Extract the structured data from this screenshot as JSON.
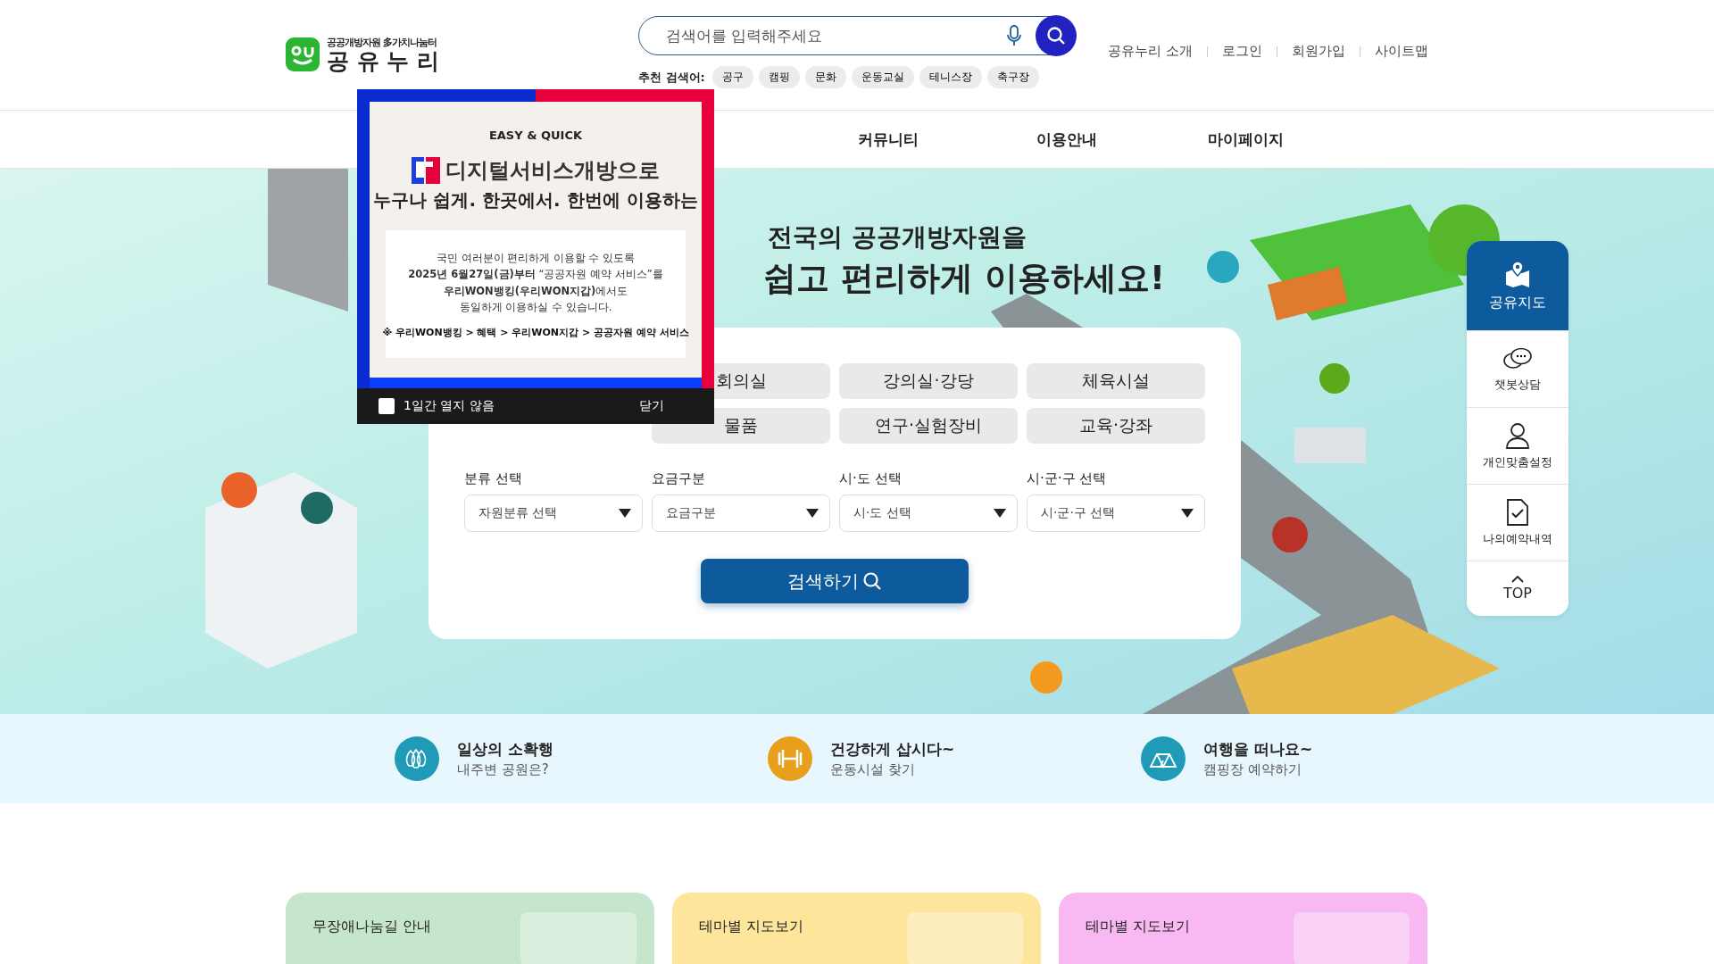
{
  "header": {
    "logo": {
      "tagline": "공공개방자원 多가치나눔터",
      "name": "공 유 누 리"
    },
    "search": {
      "placeholder": "검색어를 입력해주세요"
    },
    "recommended": {
      "label": "추천 검색어:",
      "keywords": [
        "공구",
        "캠핑",
        "문화",
        "운동교실",
        "테니스장",
        "축구장"
      ]
    },
    "top_links": [
      "공유누리 소개",
      "로그인",
      "회원가입",
      "사이트맵"
    ]
  },
  "nav": {
    "items": [
      "커뮤니티",
      "이용안내",
      "마이페이지"
    ]
  },
  "hero": {
    "title_line_1": "전국의 공공개방자원을",
    "title_line_2": "쉽고 편리하게 이용하세요!",
    "categories": [
      "회의실",
      "강의실·강당",
      "체육시설",
      "물품",
      "연구·실험장비",
      "교육·강좌"
    ],
    "filters": [
      {
        "label": "분류 선택",
        "value": "자원분류 선택"
      },
      {
        "label": "요금구분",
        "value": "요금구분"
      },
      {
        "label": "시·도 선택",
        "value": "시·도 선택"
      },
      {
        "label": "시·군·구 선택",
        "value": "시·군·구 선택"
      }
    ],
    "search_button": "검색하기"
  },
  "popup": {
    "kicker": "EASY & QUICK",
    "headline_1": "디지털서비스개방으로",
    "headline_2": "누구나 **쉽게. 한곳에서. 한번에** 이용하는",
    "body": [
      "국민 여러분이  편리하게 이용할 수 있도록",
      "**2025년 6월27일(금)부터** “공공자원 예약 서비스”를",
      "**우리WON뱅킹(우리WON지갑)**에서도",
      "동일하게 이용하실 수 있습니다."
    ],
    "path": "※ 우리WON뱅킹 > 혜택 > 우리WON지갑 > 공공자원 예약 서비스",
    "dont_show": {
      "label": "1일간 열지 않음",
      "checked": false
    },
    "close": "닫기"
  },
  "quick_menu": {
    "items": [
      {
        "label": "공유지도",
        "selected": true
      },
      {
        "label": "챗봇상담",
        "selected": false
      },
      {
        "label": "개인맞춤설정",
        "selected": false
      },
      {
        "label": "나의예약내역",
        "selected": false
      },
      {
        "label": "TOP",
        "selected": false
      }
    ]
  },
  "promos": [
    {
      "title": "일상의 소확행",
      "subtitle": "내주변 공원은?",
      "color": "#1f9bb8"
    },
    {
      "title": "건강하게 삽시다~",
      "subtitle": "운동시설 찾기",
      "color": "#e8a01c"
    },
    {
      "title": "여행을 떠나요~",
      "subtitle": "캠핑장 예약하기",
      "color": "#1f9bb8"
    }
  ],
  "cards": [
    {
      "title": "무장애나눔길 안내",
      "color": "#c6e5cd"
    },
    {
      "title": "테마별 지도보기",
      "color": "#fde59b"
    },
    {
      "title": "테마별 지도보기",
      "color": "#f8b8f1"
    }
  ]
}
